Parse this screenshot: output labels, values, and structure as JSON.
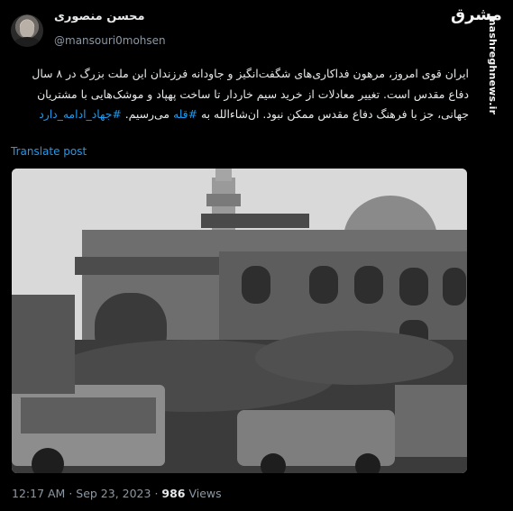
{
  "author": {
    "display_name": "محسن منصوری",
    "handle": "@mansouri0mohsen"
  },
  "branding": {
    "logo_text": "مشرق",
    "url": "mashreghnews.ir"
  },
  "tweet": {
    "text_part1": "ایران قوی امروز، مرهون فداکاری‌های شگفت‌انگیز و جاودانه فرزندان این ملت بزرگ در ۸ سال دفاع مقدس است. تغییر معادلات از خرید سیم خاردار تا ساخت پهپاد و موشک‌هایی با مشتریان جهانی، جز با فرهنگ دفاع مقدس ممکن نبود. ان‌شاءالله به ",
    "hashtag_qolle": "#قله",
    "text_part2": " می‌رسیم. ",
    "hashtag_jihad": "#جهاد_ادامه_دارد",
    "translate_label": "Translate post"
  },
  "meta": {
    "time": "12:17 AM",
    "separator": " · ",
    "date": "Sep 23, 2023",
    "views_count": "986",
    "views_label": " Views"
  },
  "colors": {
    "background": "#000000",
    "text": "#e7e9ea",
    "secondary_text": "#8b98a5",
    "link": "#1d9bf0"
  }
}
